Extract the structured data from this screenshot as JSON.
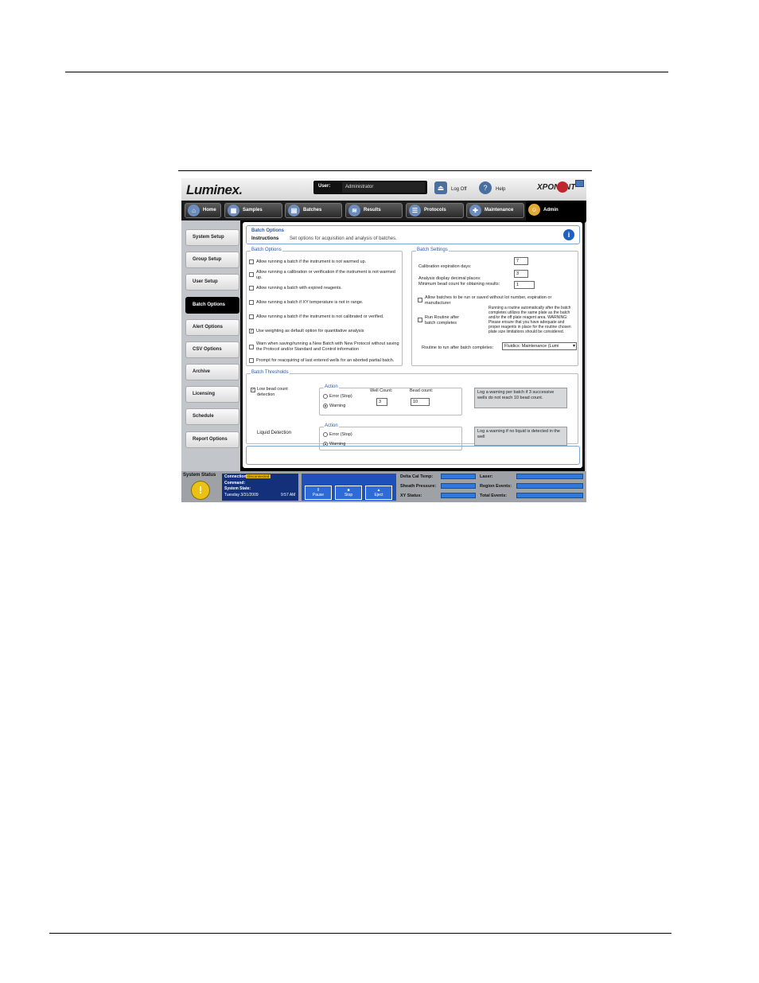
{
  "app": {
    "logo": "Luminex.",
    "user_label": "User:",
    "user_value": "Administrator",
    "logoff_label": "Log Off",
    "help_label": "Help",
    "brand": "XPONENT"
  },
  "tabs": [
    {
      "label": "Home",
      "icon": "home-icon"
    },
    {
      "label": "Samples",
      "icon": "samples-icon"
    },
    {
      "label": "Batches",
      "icon": "batches-icon"
    },
    {
      "label": "Results",
      "icon": "results-icon"
    },
    {
      "label": "Protocols",
      "icon": "protocols-icon"
    },
    {
      "label": "Maintenance",
      "icon": "maintenance-icon"
    },
    {
      "label": "Admin",
      "icon": "admin-icon"
    }
  ],
  "sidebar": [
    {
      "label": "System Setup"
    },
    {
      "label": "Group Setup"
    },
    {
      "label": "User Setup"
    },
    {
      "label": "Batch Options"
    },
    {
      "label": "Alert Options"
    },
    {
      "label": "CSV Options"
    },
    {
      "label": "Archive"
    },
    {
      "label": "Licensing"
    },
    {
      "label": "Schedule"
    },
    {
      "label": "Report Options"
    }
  ],
  "header": {
    "title": "Batch Options",
    "instructions_label": "Instructions",
    "instructions_text": "Set options for acquisition and analysis of batches."
  },
  "batch_options": {
    "label": "Batch Options",
    "items": [
      {
        "text": "Allow running a batch if the instrument is not warmed up.",
        "checked": false
      },
      {
        "text": "Allow running a calibration or verification if the instrument is not warmed up.",
        "checked": false
      },
      {
        "text": "Allow running a batch with expired reagents.",
        "checked": false
      },
      {
        "text": "Allow running a batch if XY temperature is not in range.",
        "checked": false
      },
      {
        "text": "Allow running a batch if the instrument is not calibrated or verified.",
        "checked": false
      },
      {
        "text": "Use weighting as default option for quantitative analysis",
        "checked": true
      },
      {
        "text": "Warn when saving/running a New Batch with New Protocol without saving the Protocol and/or Standard and Control information",
        "checked": false
      },
      {
        "text": "Prompt for reacquiring of last entered wells for an aborted partial batch.",
        "checked": false
      }
    ]
  },
  "batch_settings": {
    "label": "Batch Settings",
    "cal_exp_label": "Calibration expiration days:",
    "cal_exp_value": "7",
    "decimal_label": "Analysis display decimal places:",
    "decimal_value": "3",
    "min_bead_label": "Minimum bead count for obtaining results:",
    "min_bead_value": "1",
    "allow_unlot_text": "Allow batches to be run or saved without lot number, expiration or manufacturer",
    "run_routine_text": "Run Routine after batch completes",
    "run_routine_warning": "Running a routine automatically after the batch completes utilizes the same plate as the batch and/or the off plate reagent area. WARNING: Please ensure that you have adequate and proper reagents in place for the routine chosen plate size limitations should be considered.",
    "routine_label": "Routine to run after batch completes:",
    "routine_value": "Fluidics: Maintenance (Lumi"
  },
  "thresholds": {
    "label": "Batch Thresholds",
    "low_bead_text": "Low bead count detection",
    "low_bead_checked": true,
    "action_label": "Action",
    "error_label": "Error (Stop)",
    "warning_label": "Warning",
    "well_count_label": "Well Count:",
    "well_count_value": "3",
    "bead_count_label": "Bead count:",
    "bead_count_value": "10",
    "low_bead_note": "Log a warning per batch if 3 successive wells do not reach 10 bead count.",
    "liquid_label": "Liquid Detection",
    "liquid_note": "Log a warning if no liquid is detected in the well"
  },
  "status": {
    "system_status_label": "System Status",
    "connection_label": "Connection:",
    "connection_value": "Disconnected",
    "command_label": "Command:",
    "system_state_label": "System State:",
    "date": "Tuesday 3/31/2009",
    "time": "9:57 AM",
    "pause": "Pause",
    "stop": "Stop",
    "eject": "Eject",
    "delta_cal": "Delta Cal Temp:",
    "sheath": "Sheath Pressure:",
    "xy_status": "XY Status:",
    "laser": "Laser:",
    "region_events": "Region Events:",
    "total_events": "Total Events:"
  }
}
